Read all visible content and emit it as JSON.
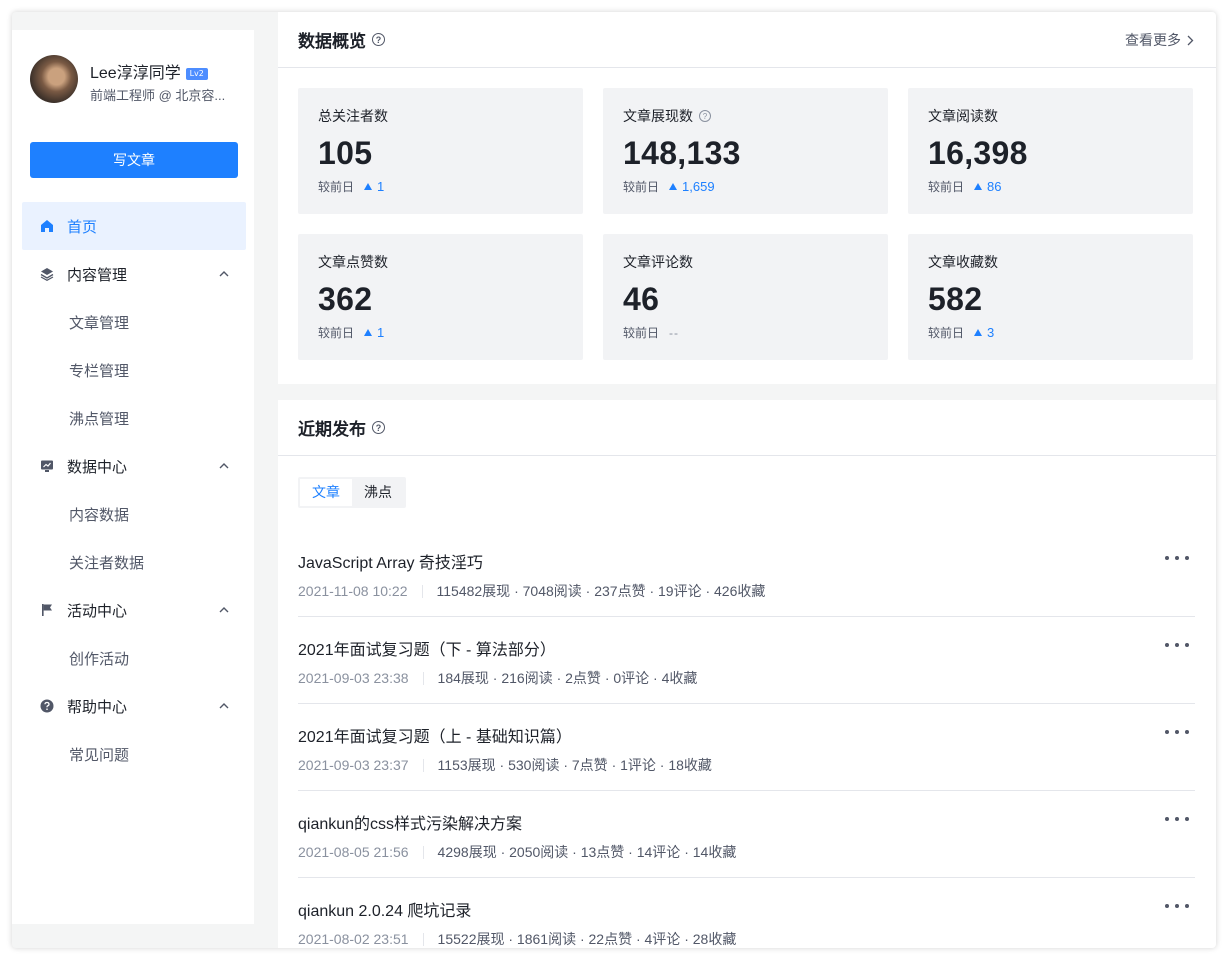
{
  "profile": {
    "username": "Lee淳淳同学",
    "level": "Lv2",
    "title": "前端工程师 @ 北京容..."
  },
  "write_button": "写文章",
  "nav": {
    "home": "首页",
    "content": {
      "label": "内容管理",
      "children": [
        "文章管理",
        "专栏管理",
        "沸点管理"
      ]
    },
    "data": {
      "label": "数据中心",
      "children": [
        "内容数据",
        "关注者数据"
      ]
    },
    "activity": {
      "label": "活动中心",
      "children": [
        "创作活动"
      ]
    },
    "help": {
      "label": "帮助中心",
      "children": [
        "常见问题"
      ]
    }
  },
  "overview": {
    "title": "数据概览",
    "more": "查看更多",
    "compare_label": "较前日",
    "cards": [
      {
        "label": "总关注者数",
        "value": "105",
        "delta": "1"
      },
      {
        "label": "文章展现数",
        "value": "148,133",
        "delta": "1,659"
      },
      {
        "label": "文章阅读数",
        "value": "16,398",
        "delta": "86"
      },
      {
        "label": "文章点赞数",
        "value": "362",
        "delta": "1"
      },
      {
        "label": "文章评论数",
        "value": "46",
        "delta": "--"
      },
      {
        "label": "文章收藏数",
        "value": "582",
        "delta": "3"
      }
    ]
  },
  "recent": {
    "title": "近期发布",
    "tabs": [
      "文章",
      "沸点"
    ],
    "items": [
      {
        "title": "JavaScript Array 奇技淫巧",
        "date": "2021-11-08 10:22",
        "stats": "115482展现 · 7048阅读 · 237点赞 · 19评论 · 426收藏"
      },
      {
        "title": "2021年面试复习题（下 - 算法部分）",
        "date": "2021-09-03 23:38",
        "stats": "184展现 · 216阅读 · 2点赞 · 0评论 · 4收藏"
      },
      {
        "title": "2021年面试复习题（上 - 基础知识篇）",
        "date": "2021-09-03 23:37",
        "stats": "1153展现 · 530阅读 · 7点赞 · 1评论 · 18收藏"
      },
      {
        "title": "qiankun的css样式污染解决方案",
        "date": "2021-08-05 21:56",
        "stats": "4298展现 · 2050阅读 · 13点赞 · 14评论 · 14收藏"
      },
      {
        "title": "qiankun 2.0.24 爬坑记录",
        "date": "2021-08-02 23:51",
        "stats": "15522展现 · 1861阅读 · 22点赞 · 4评论 · 28收藏"
      }
    ]
  },
  "colors": {
    "accent": "#1e80ff",
    "active_bg": "#eaf2ff",
    "card_bg": "#f2f3f5",
    "page_bg": "#f4f5f5"
  }
}
